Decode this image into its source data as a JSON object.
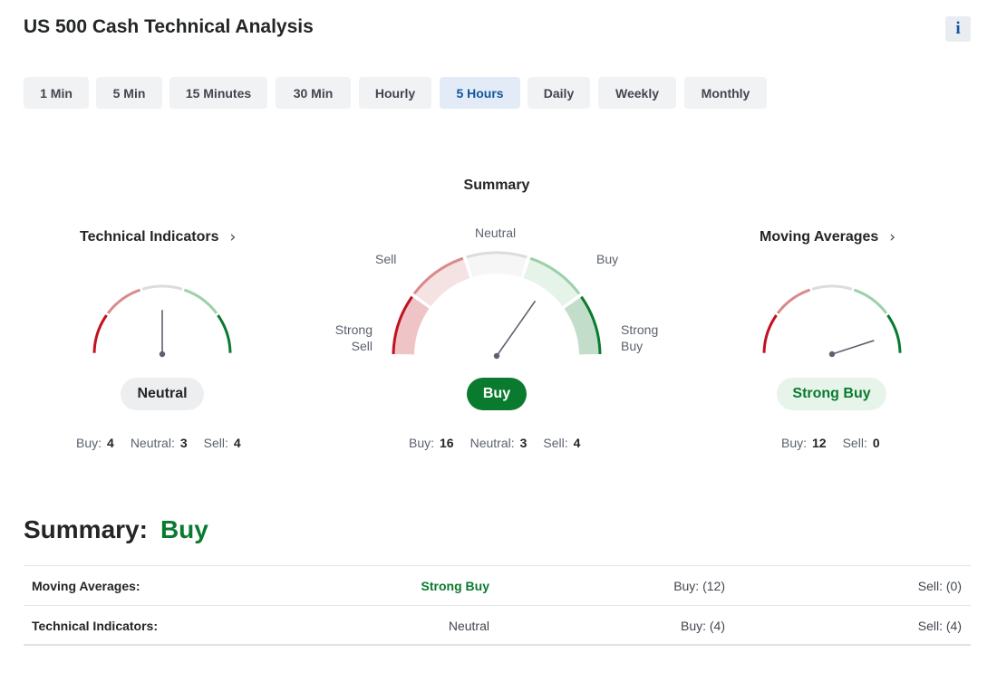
{
  "header": {
    "title": "US 500 Cash Technical Analysis",
    "info_icon": "i"
  },
  "tabs": [
    {
      "label": "1 Min",
      "active": false
    },
    {
      "label": "5 Min",
      "active": false
    },
    {
      "label": "15 Minutes",
      "active": false
    },
    {
      "label": "30 Min",
      "active": false
    },
    {
      "label": "Hourly",
      "active": false
    },
    {
      "label": "5 Hours",
      "active": true
    },
    {
      "label": "Daily",
      "active": false
    },
    {
      "label": "Weekly",
      "active": false
    },
    {
      "label": "Monthly",
      "active": false
    }
  ],
  "colors": {
    "sell": "#c1121f",
    "sell_light": "#d98a8a",
    "neutral": "#dcdcdc",
    "buy_light": "#9cd1a8",
    "buy": "#0a7a2f",
    "needle": "#5b616e"
  },
  "gauges": {
    "technical": {
      "title": "Technical Indicators",
      "chevron": "›",
      "needle": "neutral",
      "status": "Neutral",
      "counts": {
        "buy_label": "Buy:",
        "buy": "4",
        "neutral_label": "Neutral:",
        "neutral": "3",
        "sell_label": "Sell:",
        "sell": "4"
      }
    },
    "summary": {
      "title": "Summary",
      "needle": "buy",
      "status": "Buy",
      "labels": {
        "neutral": "Neutral",
        "sell": "Sell",
        "buy": "Buy",
        "strong_sell_1": "Strong",
        "strong_sell_2": "Sell",
        "strong_buy_1": "Strong",
        "strong_buy_2": "Buy"
      },
      "counts": {
        "buy_label": "Buy:",
        "buy": "16",
        "neutral_label": "Neutral:",
        "neutral": "3",
        "sell_label": "Sell:",
        "sell": "4"
      }
    },
    "moving": {
      "title": "Moving Averages",
      "chevron": "›",
      "needle": "strong buy",
      "status": "Strong Buy",
      "counts": {
        "buy_label": "Buy:",
        "buy": "12",
        "sell_label": "Sell:",
        "sell": "0"
      }
    }
  },
  "summary_section": {
    "label": "Summary:",
    "value": "Buy",
    "rows": [
      {
        "name": "Moving Averages:",
        "signal": "Strong Buy",
        "buy": "Buy: (12)",
        "sell": "Sell: (0)"
      },
      {
        "name": "Technical Indicators:",
        "signal": "Neutral",
        "buy": "Buy: (4)",
        "sell": "Sell: (4)"
      }
    ]
  }
}
